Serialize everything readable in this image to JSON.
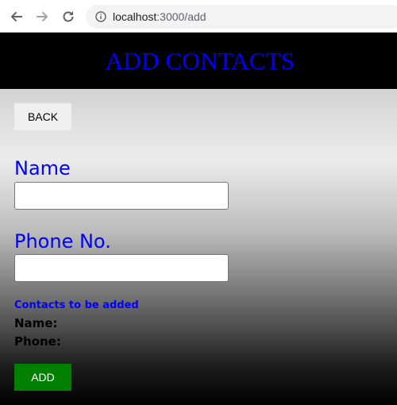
{
  "browser": {
    "url_host": "localhost",
    "url_path": ":3000/add",
    "icons": [
      "back-arrow-icon",
      "forward-arrow-icon",
      "reload-icon",
      "info-icon"
    ]
  },
  "header": {
    "title": "ADD CONTACTS"
  },
  "form": {
    "back_label": "BACK",
    "name_label": "Name",
    "name_value": "",
    "phone_label": "Phone No.",
    "phone_value": "",
    "add_label": "ADD"
  },
  "pending": {
    "heading": "Contacts to be added",
    "name_label": "Name:",
    "phone_label": "Phone:"
  },
  "colors": {
    "header_bg": "#000000",
    "title": "#0000ff",
    "labels": "#0000ff",
    "add_button": "#008000",
    "back_button": "#efefef"
  }
}
